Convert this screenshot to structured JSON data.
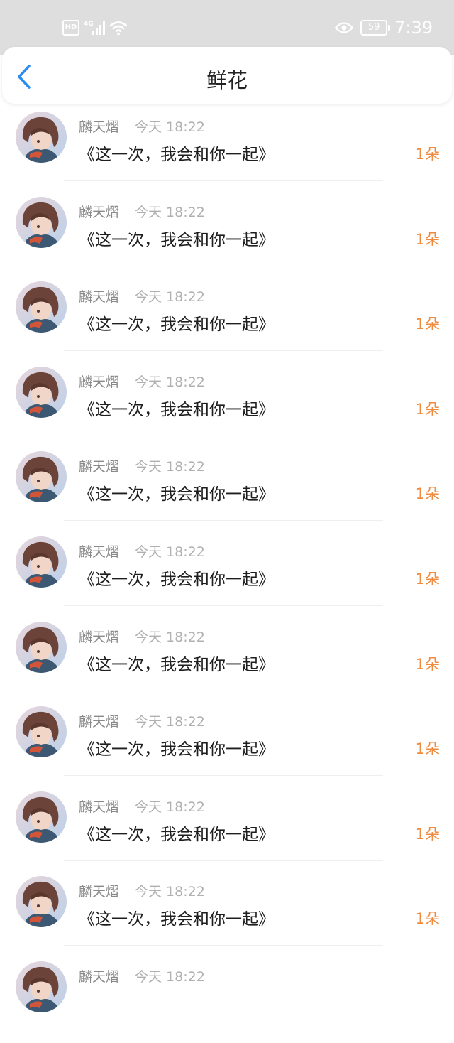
{
  "status_bar": {
    "hd_badge": "HD",
    "network_label": "4G",
    "battery_level": "59",
    "time": "7:39",
    "icons": [
      "hd-icon",
      "signal-icon",
      "wifi-icon",
      "eye-icon",
      "battery-icon"
    ]
  },
  "header": {
    "title": "鲜花",
    "back_icon": "chevron-left-icon"
  },
  "colors": {
    "accent_blue": "#2d8cf0",
    "count_orange": "#f08a3c",
    "status_bar_bg": "#dedede"
  },
  "items": [
    {
      "name": "麟天熠",
      "time": "今天 18:22",
      "message": "《这一次，我会和你一起》",
      "count": "1朵"
    },
    {
      "name": "麟天熠",
      "time": "今天 18:22",
      "message": "《这一次，我会和你一起》",
      "count": "1朵"
    },
    {
      "name": "麟天熠",
      "time": "今天 18:22",
      "message": "《这一次，我会和你一起》",
      "count": "1朵"
    },
    {
      "name": "麟天熠",
      "time": "今天 18:22",
      "message": "《这一次，我会和你一起》",
      "count": "1朵"
    },
    {
      "name": "麟天熠",
      "time": "今天 18:22",
      "message": "《这一次，我会和你一起》",
      "count": "1朵"
    },
    {
      "name": "麟天熠",
      "time": "今天 18:22",
      "message": "《这一次，我会和你一起》",
      "count": "1朵"
    },
    {
      "name": "麟天熠",
      "time": "今天 18:22",
      "message": "《这一次，我会和你一起》",
      "count": "1朵"
    },
    {
      "name": "麟天熠",
      "time": "今天 18:22",
      "message": "《这一次，我会和你一起》",
      "count": "1朵"
    },
    {
      "name": "麟天熠",
      "time": "今天 18:22",
      "message": "《这一次，我会和你一起》",
      "count": "1朵"
    },
    {
      "name": "麟天熠",
      "time": "今天 18:22",
      "message": "《这一次，我会和你一起》",
      "count": "1朵"
    },
    {
      "name": "麟天熠",
      "time": "今天 18:22",
      "message": "",
      "count": ""
    }
  ]
}
